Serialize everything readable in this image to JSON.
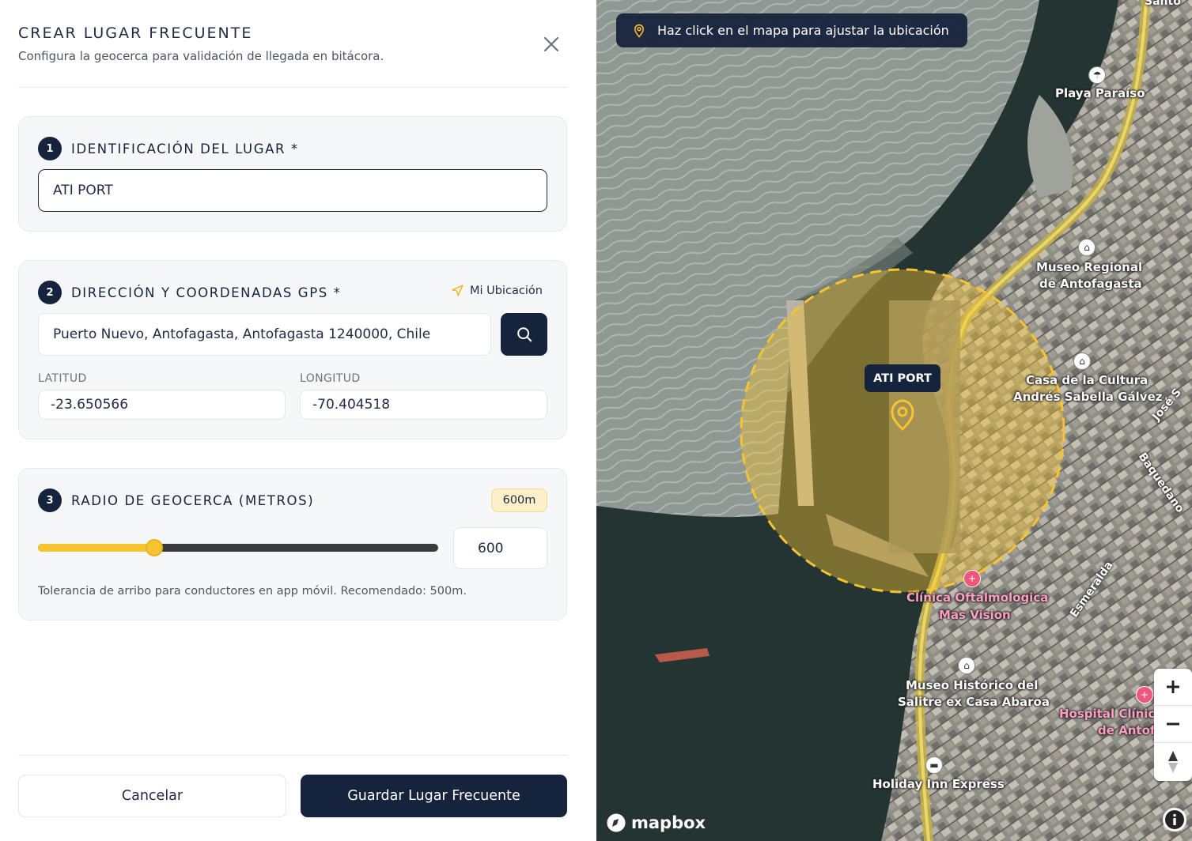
{
  "modal": {
    "title": "CREAR LUGAR FRECUENTE",
    "subtitle": "Configura la geocerca para validación de llegada en bitácora."
  },
  "section1": {
    "number": "1",
    "title": "IDENTIFICACIÓN DEL LUGAR *",
    "name_value": "ATI PORT"
  },
  "section2": {
    "number": "2",
    "title": "DIRECCIÓN Y COORDENADAS GPS *",
    "my_location_label": "Mi Ubicación",
    "address_value": "Puerto Nuevo, Antofagasta, Antofagasta 1240000, Chile",
    "lat_label": "LATITUD",
    "lat_value": "-23.650566",
    "lng_label": "LONGITUD",
    "lng_value": "-70.404518"
  },
  "section3": {
    "number": "3",
    "title": "RADIO DE GEOCERCA (METROS)",
    "badge": "600m",
    "radius_value": "600",
    "slider_fraction": 0.29,
    "hint": "Tolerancia de arribo para conductores en app móvil. Recomendado: 500m."
  },
  "footer": {
    "cancel_label": "Cancelar",
    "save_label": "Guardar Lugar Frecuente"
  },
  "map": {
    "banner": "Haz click en el mapa para ajustar la ubicación",
    "marker_label": "ATI PORT",
    "pois": {
      "playa": "Playa Paraíso",
      "museo_regional_1": "Museo Regional",
      "museo_regional_2": "de Antofagasta",
      "casa_cultura_1": "Casa de la Cultura",
      "casa_cultura_2": "Andrés Sabella Gálvez",
      "clinica_1": "Clínica Oftalmologica",
      "clinica_2": "Mas Vision",
      "museo_salitre_1": "Museo Histórico del",
      "museo_salitre_2": "Salitre ex Casa Abaroa",
      "hospital_1": "Hospital Clínico",
      "hospital_2": "de Antofa",
      "holiday": "Holiday Inn Express"
    },
    "streets": {
      "santo": "Santo",
      "jose": "José S",
      "baquedano": "Baquedano",
      "esmeralda": "Esmeralda"
    },
    "attribution": "mapbox",
    "geofence_color": "#f6c431"
  }
}
